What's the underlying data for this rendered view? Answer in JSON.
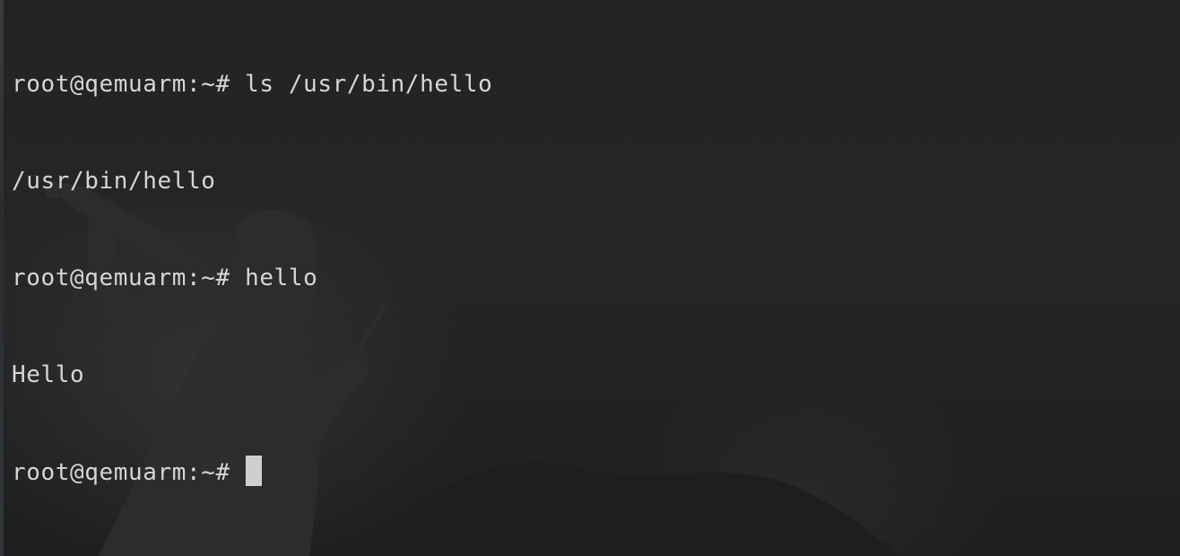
{
  "terminal": {
    "lines": [
      {
        "prompt": "root@qemuarm:~# ",
        "command": "ls /usr/bin/hello"
      },
      {
        "output": "/usr/bin/hello"
      },
      {
        "prompt": "root@qemuarm:~# ",
        "command": "hello"
      },
      {
        "output": "Hello"
      },
      {
        "prompt": "root@qemuarm:~# ",
        "command": ""
      }
    ]
  },
  "colors": {
    "background": "#222324",
    "text": "#d6d6d6",
    "cursor": "#cfcfcf"
  }
}
